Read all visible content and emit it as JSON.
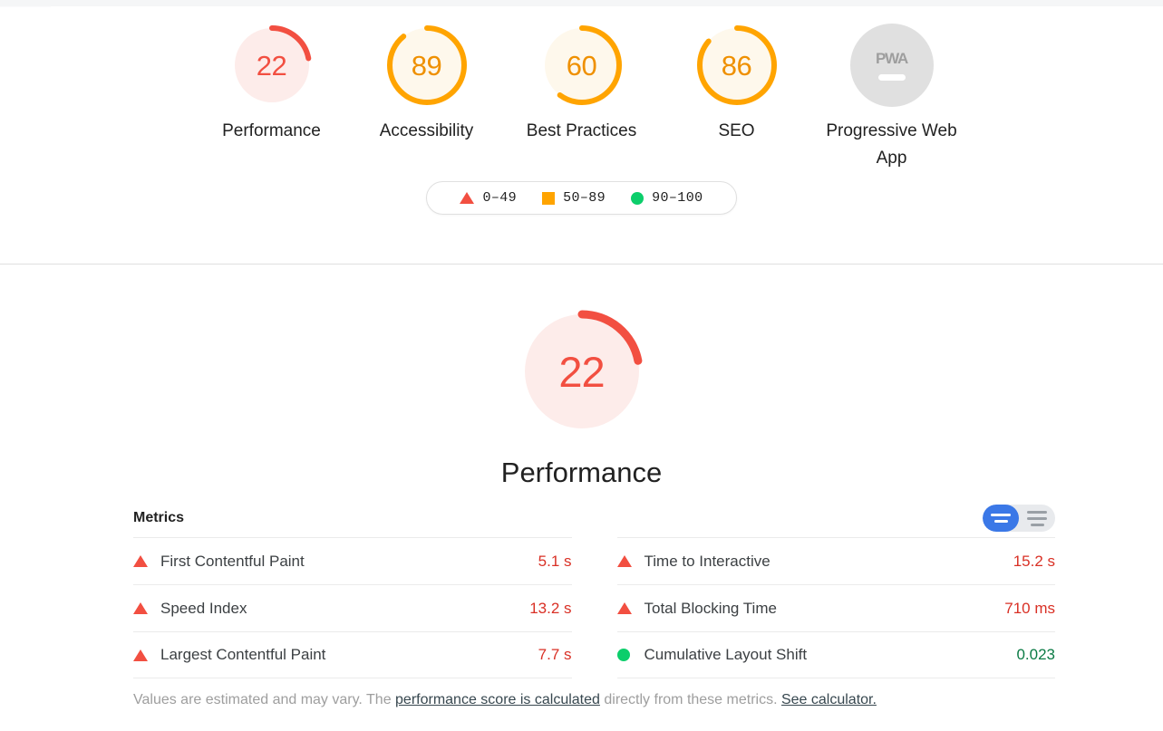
{
  "header": {
    "gauges": [
      {
        "score": "22",
        "label": "Performance",
        "color": "#f24f41",
        "bg": "#fdecea",
        "pct": 22
      },
      {
        "score": "89",
        "label": "Accessibility",
        "color": "#ffa400",
        "bg": "#fef8ec",
        "pct": 89
      },
      {
        "score": "60",
        "label": "Best Practices",
        "color": "#ffa400",
        "bg": "#fef8ec",
        "pct": 60
      },
      {
        "score": "86",
        "label": "SEO",
        "color": "#ffa400",
        "bg": "#fef8ec",
        "pct": 86
      }
    ],
    "pwa": {
      "badge_text": "PWA",
      "label": "Progressive Web App"
    },
    "legend": [
      {
        "shape": "triangle-icon",
        "range": "0–49",
        "color": "#f24f41"
      },
      {
        "shape": "square-icon",
        "range": "50–89",
        "color": "#ffa400"
      },
      {
        "shape": "circle-icon",
        "range": "90–100",
        "color": "#0cce6b"
      }
    ]
  },
  "category": {
    "score": "22",
    "title": "Performance",
    "color": "#f24f41",
    "bg": "#fdecea",
    "pct": 22
  },
  "metrics": {
    "title": "Metrics",
    "toggle": {
      "simple_label": "simple-view",
      "expanded_label": "expanded-view",
      "active": "simple"
    },
    "left_column": [
      {
        "status": "fail",
        "name": "First Contentful Paint",
        "value": "5.1 s"
      },
      {
        "status": "fail",
        "name": "Speed Index",
        "value": "13.2 s"
      },
      {
        "status": "fail",
        "name": "Largest Contentful Paint",
        "value": "7.7 s"
      }
    ],
    "right_column": [
      {
        "status": "fail",
        "name": "Time to Interactive",
        "value": "15.2 s"
      },
      {
        "status": "fail",
        "name": "Total Blocking Time",
        "value": "710 ms"
      },
      {
        "status": "pass",
        "name": "Cumulative Layout Shift",
        "value": "0.023"
      }
    ],
    "note": {
      "part1": "Values are estimated and may vary. The ",
      "link1": "performance score is calculated",
      "part2": " directly from these metrics. ",
      "link2": "See calculator."
    }
  },
  "colors": {
    "fail": "#f24f41",
    "average": "#ffa400",
    "pass": "#0cce6b",
    "fail_text": "#d93025",
    "pass_text": "#0b7b45",
    "accent_blue": "#3b78e7"
  }
}
